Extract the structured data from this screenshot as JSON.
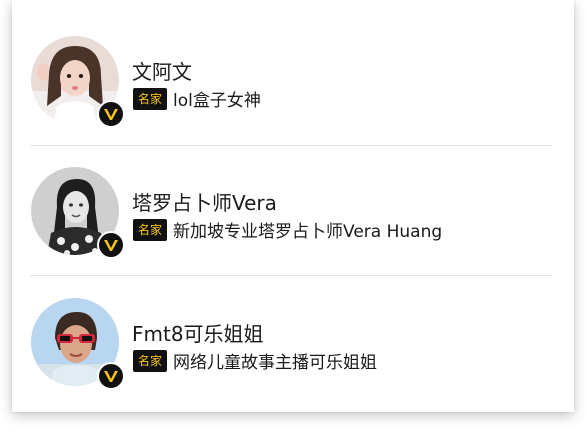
{
  "people": [
    {
      "name": "文阿文",
      "badge_label": "名家",
      "description": "lol盒子女神",
      "avatar_icon": "avatar-photo-woman-pink",
      "verified_icon": "verified-v-icon"
    },
    {
      "name": "塔罗占卜师Vera",
      "badge_label": "名家",
      "description": "新加坡专业塔罗占卜师Vera Huang",
      "avatar_icon": "avatar-photo-woman-bw",
      "verified_icon": "verified-v-icon"
    },
    {
      "name": "Fmt8可乐姐姐",
      "badge_label": "名家",
      "description": "网络儿童故事主播可乐姐姐",
      "avatar_icon": "avatar-photo-woman-sunglasses",
      "verified_icon": "verified-v-icon"
    }
  ],
  "colors": {
    "tag_bg": "#111111",
    "tag_text": "#f5c518",
    "badge_v": "#f5c518",
    "divider": "#e6e6e6"
  }
}
